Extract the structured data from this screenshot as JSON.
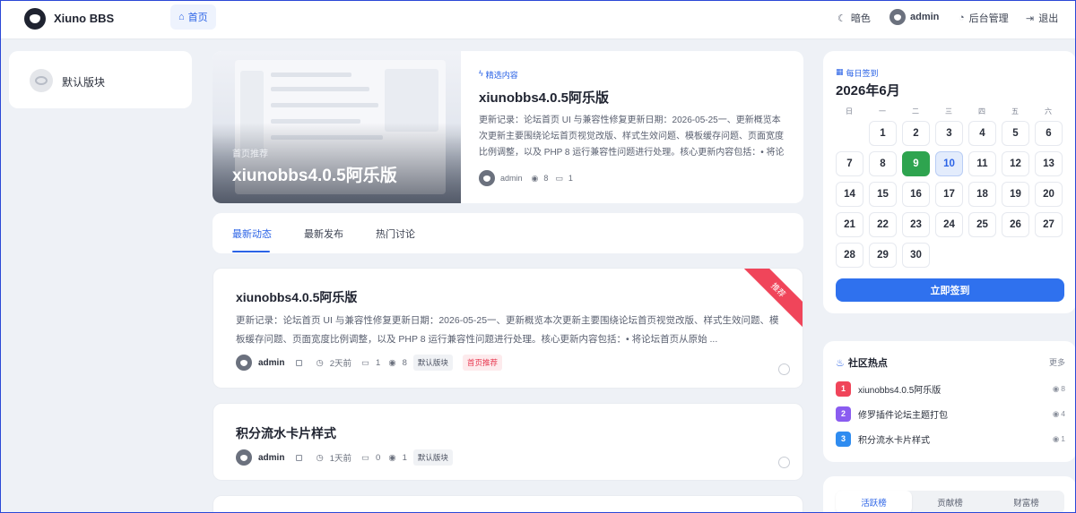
{
  "header": {
    "brand": "Xiuno BBS",
    "nav_home": "首页",
    "dark_mode": "暗色",
    "user": "admin",
    "admin_panel": "后台管理",
    "logout": "退出"
  },
  "left_sidebar": {
    "forum_label": "默认版块"
  },
  "featured": {
    "image_tag": "首页推荐",
    "image_title": "xiunobbs4.0.5阿乐版",
    "badge": "精选内容",
    "title": "xiunobbs4.0.5阿乐版",
    "excerpt": "更新记录：论坛首页 UI 与兼容性修复更新日期：2026-05-25一、更新概览本次更新主要围绕论坛首页视觉改版、样式生效问题、模板缓存问题、页面宽度比例调整，以及 PHP 8 运行兼容性问题进行处理。核心更新内容包括：• 将论坛首页...",
    "author": "admin",
    "views": "8",
    "comments": "1"
  },
  "tabs": [
    "最新动态",
    "最新发布",
    "热门讨论"
  ],
  "posts": [
    {
      "title": "xiunobbs4.0.5阿乐版",
      "ribbon": "推荐",
      "excerpt": "更新记录：论坛首页 UI 与兼容性修复更新日期：2026-05-25一、更新概览本次更新主要围绕论坛首页视觉改版、样式生效问题、模板缓存问题、页面宽度比例调整，以及 PHP 8 运行兼容性问题进行处理。核心更新内容包括：• 将论坛首页从原始 ...",
      "author": "admin",
      "time": "2天前",
      "comments": "1",
      "views": "8",
      "forum": "默认版块",
      "tag": "首页推荐"
    },
    {
      "title": "积分流水卡片样式",
      "author": "admin",
      "time": "1天前",
      "comments": "0",
      "views": "1",
      "forum": "默认版块"
    }
  ],
  "calendar": {
    "heading": "每日签到",
    "month": "2026年6月",
    "weekdays": [
      "日",
      "一",
      "二",
      "三",
      "四",
      "五",
      "六"
    ],
    "days": [
      "1",
      "2",
      "3",
      "4",
      "5",
      "6",
      "7",
      "8",
      "9",
      "10",
      "11",
      "12",
      "13",
      "14",
      "15",
      "16",
      "17",
      "18",
      "19",
      "20",
      "21",
      "22",
      "23",
      "24",
      "25",
      "26",
      "27",
      "28",
      "29",
      "30"
    ],
    "today": "9",
    "selected": "10",
    "sign_button": "立即签到"
  },
  "hot": {
    "title": "社区热点",
    "more": "更多",
    "items": [
      {
        "rank": "1",
        "title": "xiunobbs4.0.5阿乐版",
        "views": "8",
        "color": "#f0455a"
      },
      {
        "rank": "2",
        "title": "修罗插件论坛主题打包",
        "views": "4",
        "color": "#8a5cf0"
      },
      {
        "rank": "3",
        "title": "积分流水卡片样式",
        "views": "1",
        "color": "#2f8cf0"
      }
    ]
  },
  "ranking": {
    "tabs": [
      "活跃榜",
      "贡献榜",
      "财富榜"
    ]
  }
}
